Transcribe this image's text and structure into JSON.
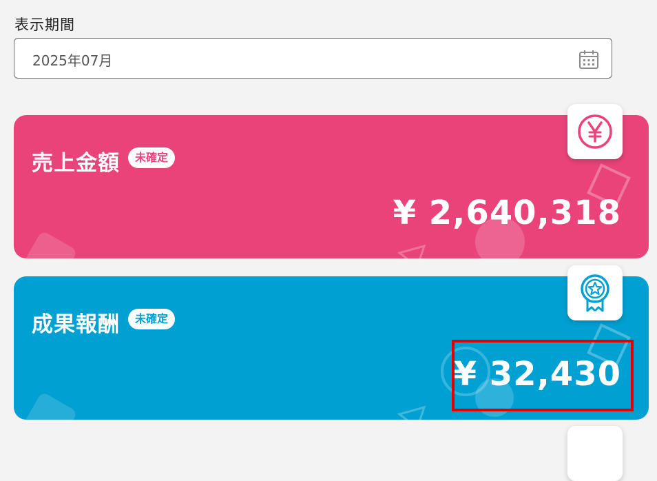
{
  "period": {
    "label": "表示期間",
    "value": "2025年07月",
    "icon": "calendar-icon"
  },
  "cards": [
    {
      "title": "売上金額",
      "badge": "未確定",
      "amount": "¥ 2,640,318",
      "icon": "yen-icon",
      "color": "#ea437a"
    },
    {
      "title": "成果報酬",
      "badge": "未確定",
      "amount": "¥ 32,430",
      "icon": "award-ribbon-icon",
      "color": "#00a0d2"
    }
  ],
  "colors": {
    "background": "#f3f3f3",
    "highlight": "#e00000"
  }
}
